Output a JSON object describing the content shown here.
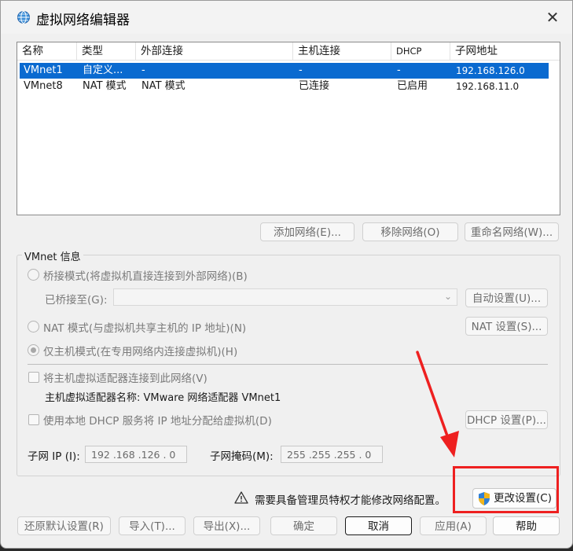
{
  "window": {
    "title": "虚拟网络编辑器",
    "close_glyph": "✕"
  },
  "table": {
    "headers": [
      "名称",
      "类型",
      "外部连接",
      "主机连接",
      "DHCP",
      "子网地址"
    ],
    "rows": [
      {
        "name": "VMnet1",
        "type": "自定义...",
        "external": "-",
        "host": "-",
        "dhcp": "-",
        "subnet": "192.168.126.0",
        "selected": true
      },
      {
        "name": "VMnet8",
        "type": "NAT 模式",
        "external": "NAT 模式",
        "host": "已连接",
        "dhcp": "已启用",
        "subnet": "192.168.11.0",
        "selected": false
      }
    ]
  },
  "list_buttons": {
    "add": "添加网络(E)...",
    "remove": "移除网络(O)",
    "rename": "重命名网络(W)..."
  },
  "vmnet_info": {
    "group_label": "VMnet 信息",
    "bridge_mode": "桥接模式(将虚拟机直接连接到外部网络)(B)",
    "bridged_to_label": "已桥接至(G):",
    "bridged_to_value": "",
    "auto_settings": "自动设置(U)...",
    "nat_mode": "NAT 模式(与虚拟机共享主机的 IP 地址)(N)",
    "nat_settings": "NAT 设置(S)...",
    "host_only": "仅主机模式(在专用网络内连接虚拟机)(H)",
    "connect_adapter": "将主机虚拟适配器连接到此网络(V)",
    "adapter_name": "主机虚拟适配器名称: VMware 网络适配器 VMnet1",
    "use_dhcp": "使用本地 DHCP 服务将 IP 地址分配给虚拟机(D)",
    "dhcp_settings": "DHCP 设置(P)...",
    "subnet_ip_label": "子网 IP (I):",
    "subnet_ip_value": "192 .168 .126 .  0",
    "subnet_mask_label": "子网掩码(M):",
    "subnet_mask_value": "255 .255 .255 .  0",
    "selected_mode": "host_only"
  },
  "admin_notice": {
    "text": "需要具备管理员特权才能修改网络配置。",
    "change_settings": "更改设置(C)"
  },
  "footer": {
    "restore": "还原默认设置(R)",
    "import": "导入(T)...",
    "export": "导出(X)...",
    "ok": "确定",
    "cancel": "取消",
    "apply": "应用(A)",
    "help": "帮助"
  },
  "colors": {
    "selection": "#0a6ad0",
    "annotation": "#ee2020"
  }
}
